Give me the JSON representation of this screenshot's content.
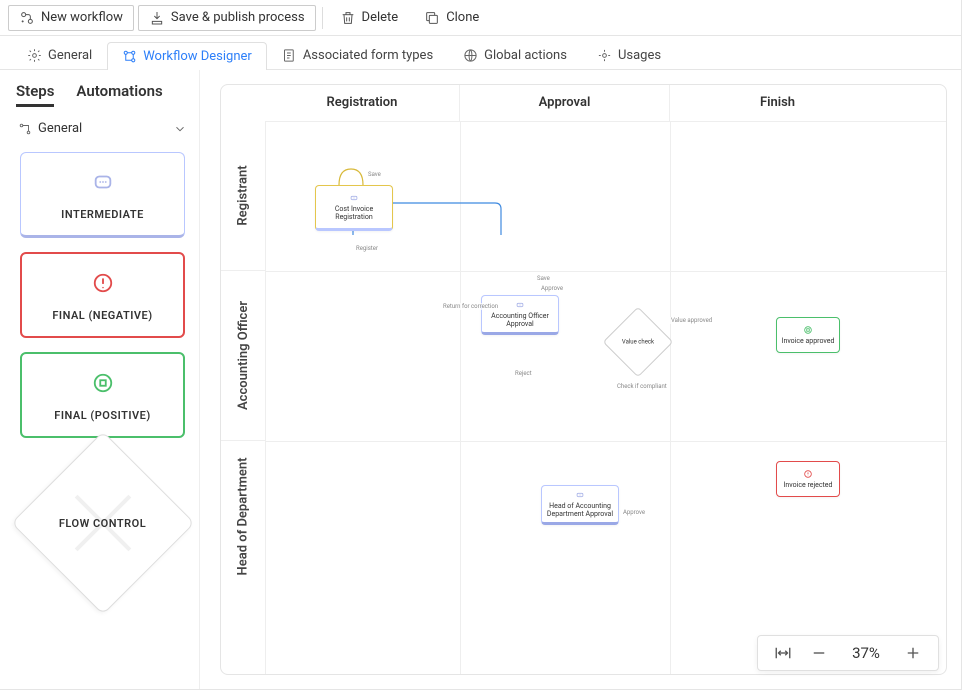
{
  "toolbar": {
    "new": "New workflow",
    "save": "Save & publish process",
    "delete": "Delete",
    "clone": "Clone"
  },
  "tabs": {
    "general": "General",
    "designer": "Workflow Designer",
    "forms": "Associated form types",
    "globals": "Global actions",
    "usages": "Usages"
  },
  "sidebar": {
    "steps": "Steps",
    "automations": "Automations",
    "section": "General",
    "intermediate": "INTERMEDIATE",
    "final_neg": "FINAL (NEGATIVE)",
    "final_pos": "FINAL (POSITIVE)",
    "flow": "FLOW CONTROL"
  },
  "columns": {
    "c1": "Registration",
    "c2": "Approval",
    "c3": "Finish"
  },
  "rows": {
    "r1": "Registrant",
    "r2": "Accounting Officer",
    "r3": "Head of Department"
  },
  "nodes": {
    "start": "Cost Invoice Registration",
    "ao": "Accounting Officer Approval",
    "hod": "Head of Accounting Department Approval",
    "gate": "Value check",
    "approved": "Invoice approved",
    "rejected": "Invoice rejected"
  },
  "labels": {
    "save": "Save",
    "register": "Register",
    "return_correction": "Return for correction",
    "approve": "Approve",
    "reject": "Reject",
    "value_approved": "Value approved",
    "check_if_compliant": "Check if compliant"
  },
  "zoom": {
    "value": "37%"
  }
}
